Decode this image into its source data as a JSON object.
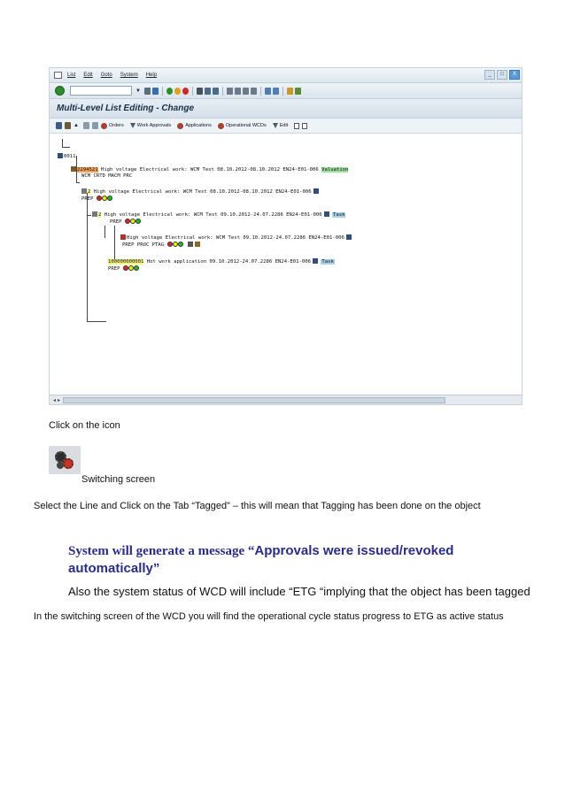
{
  "sap": {
    "menu": [
      "List",
      "Edit",
      "Goto",
      "System",
      "Help"
    ],
    "window_controls": [
      "_",
      "□",
      "X"
    ],
    "title": "Multi-Level List Editing - Change",
    "app_toolbar": {
      "orders": "Orders",
      "work_approvals": "Work Approvals",
      "applications": "Applications",
      "operational_wcds": "Operational WCDs",
      "edit": "Edit"
    },
    "tree": {
      "root": "0011",
      "n1_id": "2294521",
      "n1_desc": " High voltage Electrical work: WCM Test 08.10.2012-08.10.2012 EN24-E01-006 ",
      "n1_tag": "Valuation",
      "n1_status": "WCM  CRTD MACM PRC",
      "n2_id": "2",
      "n2_desc": " High voltage Electrical work: WCM Test 08.10.2012-08.10.2012 EN24-E01-006",
      "n2_status": "PREP",
      "n3_id": "2",
      "n3_desc": " High voltage Electrical work: WCM Test 09.10.2012-24.07.2286 EN24-E01-006",
      "n3_tag": "Task",
      "n3_status": "PREP",
      "n4_desc": "High voltage Electrical work: WCM Test 09.10.2012-24.07.2286 EN24-E01-006",
      "n4_status": "PREP PROC PTAG",
      "n5_id": "100000000001",
      "n5_desc": " Hot work application 09.10.2012-24.07.2286 EN24-E01-006",
      "n5_tag": "Task",
      "n5_status": "PREP"
    }
  },
  "doc": {
    "line1": "Click on the icon",
    "line2": "Switching screen",
    "line3": "Select the Line  and  Click on the Tab “Tagged” – this will mean that Tagging has been done on the object",
    "msg_prefix": "System will generate a message “",
    "msg_rest": "Approvals were issued/revoked automatically”",
    "line4": "Also the system status of WCD will include “ETG “implying that the object has been tagged",
    "line5": "In the switching screen of the WCD you will find the operational cycle status progress to ETG as active status"
  }
}
